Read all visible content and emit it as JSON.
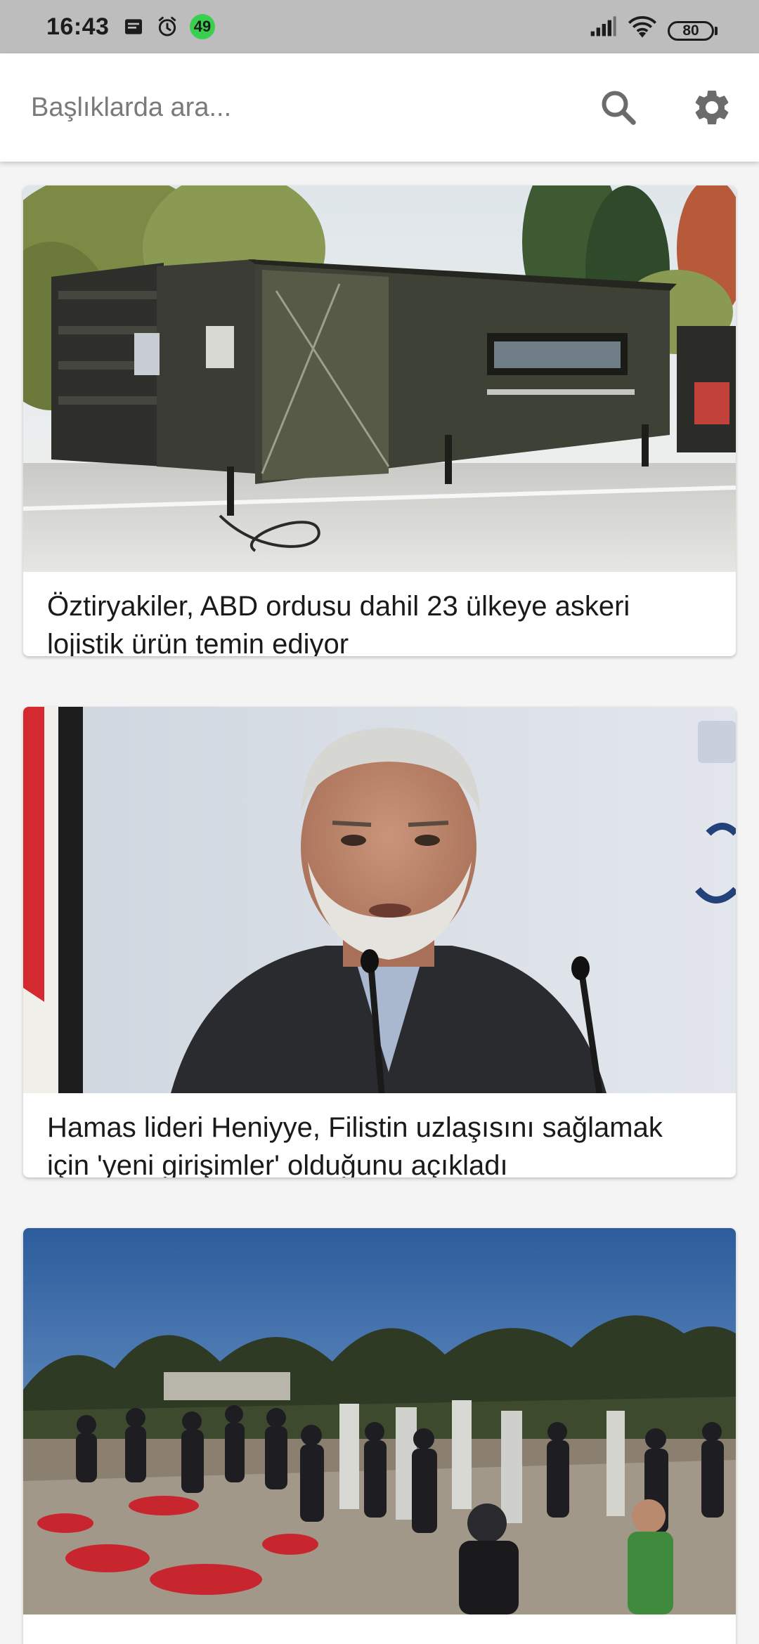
{
  "status_bar": {
    "time": "16:43",
    "notification_count": "49",
    "battery": "80",
    "icons": [
      "message-icon",
      "alarm-icon",
      "signal-icon",
      "wifi-icon",
      "battery-icon"
    ]
  },
  "search": {
    "placeholder": "Başlıklarda ara...",
    "value": "",
    "search_icon": "search-icon",
    "settings_icon": "gear-icon"
  },
  "articles": [
    {
      "title": "Öztiryakiler, ABD ordusu dahil 23 ülkeye askeri lojistik ürün temin ediyor",
      "image": "military-container-photo"
    },
    {
      "title": "Hamas lideri Heniyye, Filistin uzlaşısını sağlamak için 'yeni girişimler' olduğunu açıkladı",
      "image": "portrait-speaker-photo"
    },
    {
      "title": "",
      "image": "memorial-cemetery-crowd-photo"
    }
  ],
  "colors": {
    "status_bar_bg": "#bdbdbd",
    "header_bg": "#ffffff",
    "page_bg": "#f4f4f4",
    "icon_gray": "#6b6b6b",
    "badge_green": "#3ad04f"
  }
}
